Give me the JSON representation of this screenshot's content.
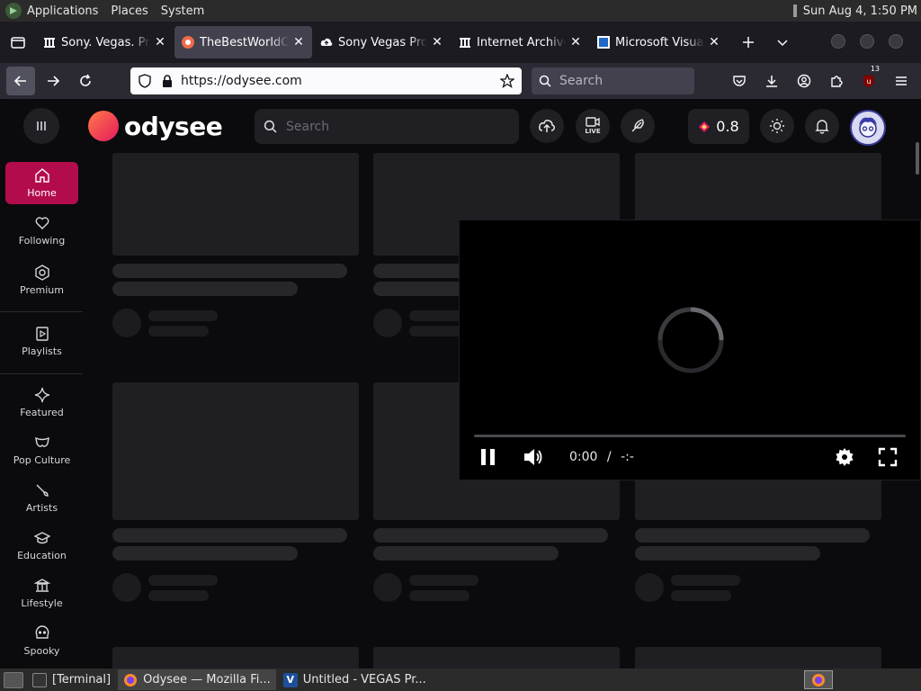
{
  "gnome": {
    "menu_applications": "Applications",
    "menu_places": "Places",
    "menu_system": "System",
    "clock": "Sun Aug  4,  1:50 PM"
  },
  "tabs": [
    {
      "title": "Sony. Vegas. Pro",
      "favicon": "archive-icon",
      "active": false
    },
    {
      "title": "TheBestWorldC",
      "favicon": "odysee-icon",
      "active": true
    },
    {
      "title": "Sony Vegas Pro",
      "favicon": "upload-icon",
      "active": false
    },
    {
      "title": "Internet Archive",
      "favicon": "archive-icon",
      "active": false
    },
    {
      "title": "Microsoft Visual",
      "favicon": "ms-icon",
      "active": false
    }
  ],
  "navbar": {
    "url": "https://odysee.com",
    "search_placeholder": "Search",
    "extension_badge": "13"
  },
  "odysee": {
    "logo_text": "odysee",
    "search_placeholder": "Search",
    "live_label": "LIVE",
    "credits": "0.8",
    "accent": "#b30c4d"
  },
  "sidebar": {
    "items": [
      {
        "label": "Home",
        "icon": "home-icon"
      },
      {
        "label": "Following",
        "icon": "heart-icon"
      },
      {
        "label": "Premium",
        "icon": "premium-icon"
      },
      {
        "label": "Playlists",
        "icon": "playlist-icon"
      },
      {
        "label": "Featured",
        "icon": "sparkle-icon"
      },
      {
        "label": "Pop Culture",
        "icon": "mask-icon"
      },
      {
        "label": "Artists",
        "icon": "brush-icon"
      },
      {
        "label": "Education",
        "icon": "graduation-icon"
      },
      {
        "label": "Lifestyle",
        "icon": "temple-icon"
      },
      {
        "label": "Spooky",
        "icon": "skull-icon"
      }
    ]
  },
  "player": {
    "current_time": "0:00",
    "separator": "/",
    "duration": "-:-"
  },
  "taskbar": {
    "items": [
      {
        "label": "[Terminal]"
      },
      {
        "label": "Odysee — Mozilla Fi..."
      },
      {
        "label": "Untitled - VEGAS Pr..."
      }
    ]
  }
}
